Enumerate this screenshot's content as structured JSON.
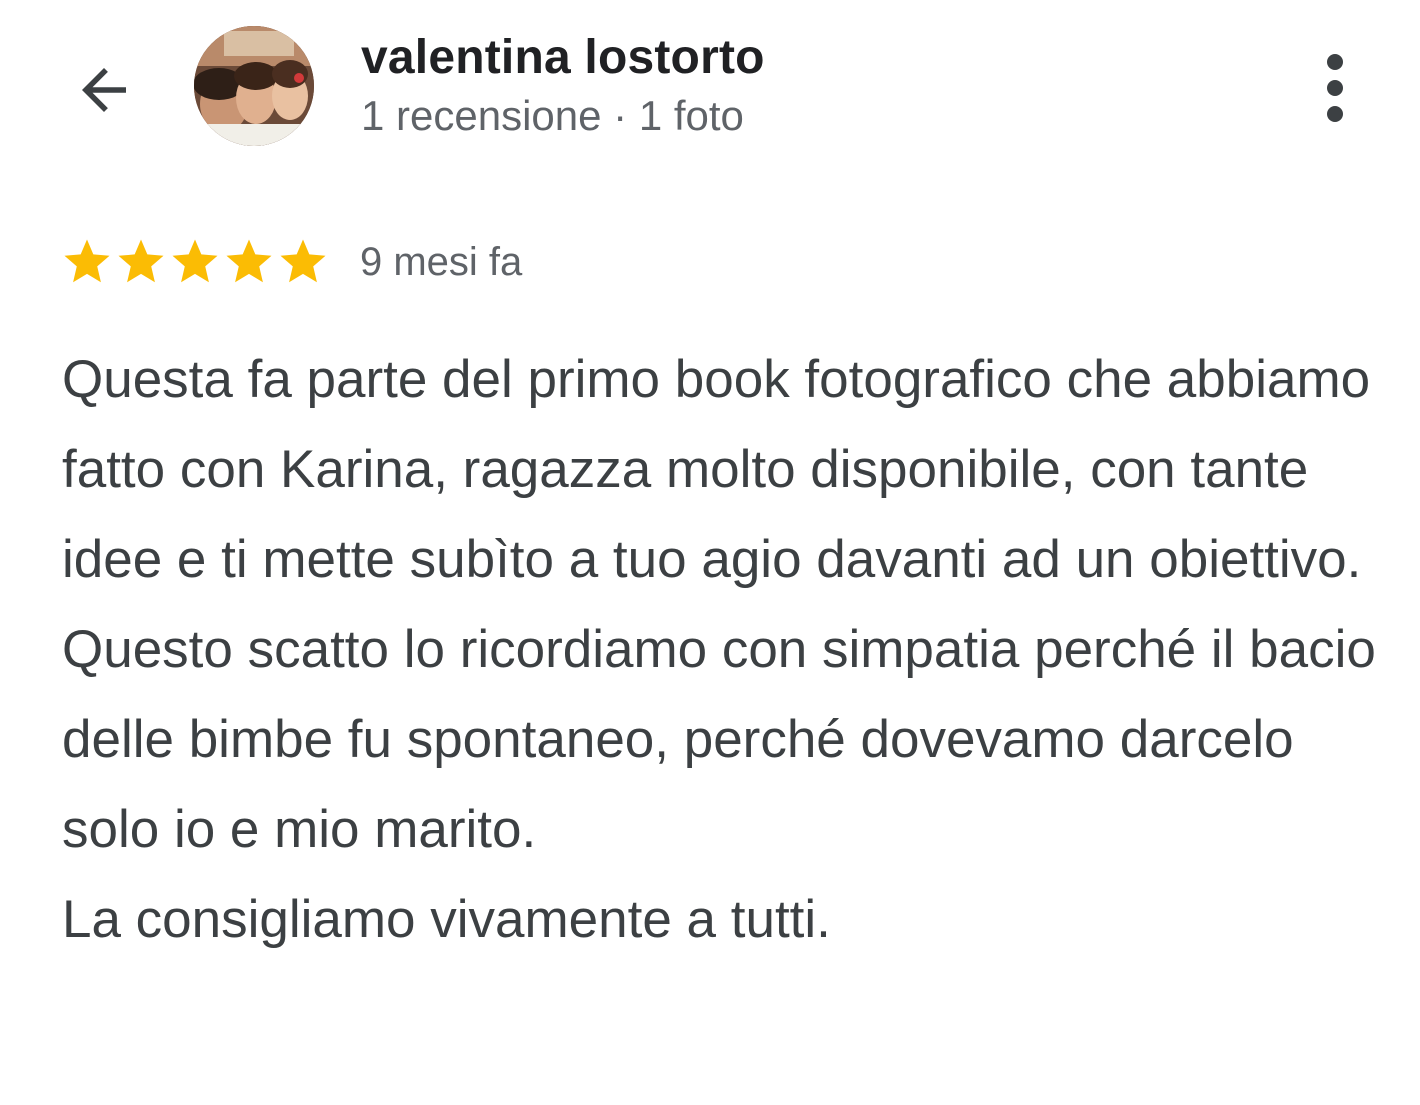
{
  "header": {
    "back_icon": "arrow-back-icon",
    "user_name": "valentina lostorto",
    "user_meta": "1 recensione · 1 foto",
    "more_icon": "more-vert-icon"
  },
  "review": {
    "rating": 5,
    "max_rating": 5,
    "star_color": "#fbbc04",
    "time": "9 mesi fa",
    "paragraphs": [
      "Questa fa parte del primo book fotografico che abbiamo fatto con Karina, ragazza molto disponibile, con tante idee e ti mette subìto a tuo agio davanti ad un obiettivo. Questo scatto lo ricordiamo con simpatia perché il bacio delle bimbe fu spontaneo, perché dovevamo darcelo solo io e mio marito.",
      "La consigliamo vivamente a tutti."
    ]
  }
}
